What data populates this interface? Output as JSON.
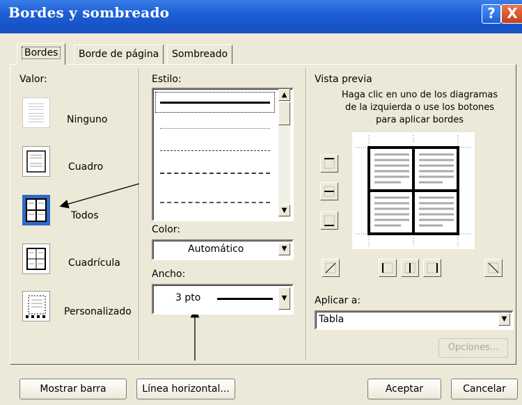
{
  "dialog": {
    "title": "Bordes y sombreado",
    "help_glyph": "?",
    "close_glyph": "X"
  },
  "tabs": [
    {
      "label": "Bordes"
    },
    {
      "label": "Borde de página"
    },
    {
      "label": "Sombreado"
    }
  ],
  "valor": {
    "heading": "Valor:",
    "presets": [
      {
        "label": "Ninguno"
      },
      {
        "label": "Cuadro"
      },
      {
        "label": "Todos"
      },
      {
        "label": "Cuadrícula"
      },
      {
        "label": "Personalizado"
      }
    ]
  },
  "estilo": {
    "heading": "Estilo:"
  },
  "color": {
    "heading": "Color:",
    "value": "Automático"
  },
  "ancho": {
    "heading": "Ancho:",
    "value": "3 pto"
  },
  "preview": {
    "heading": "Vista previa",
    "hint_line1": "Haga clic en uno de los diagramas",
    "hint_line2": "de la izquierda o use los botones",
    "hint_line3": "para aplicar bordes"
  },
  "aplicar": {
    "heading": "Aplicar a:",
    "value": "Tabla",
    "options_button": "Opciones..."
  },
  "footer": {
    "show_toolbar": "Mostrar barra",
    "horizontal_line": "Línea horizontal...",
    "ok": "Aceptar",
    "cancel": "Cancelar"
  },
  "colors": {
    "title_bar": "#1e5fd6",
    "dialog_bg": "#ece9d8",
    "selected_preset": "#316ac5"
  }
}
